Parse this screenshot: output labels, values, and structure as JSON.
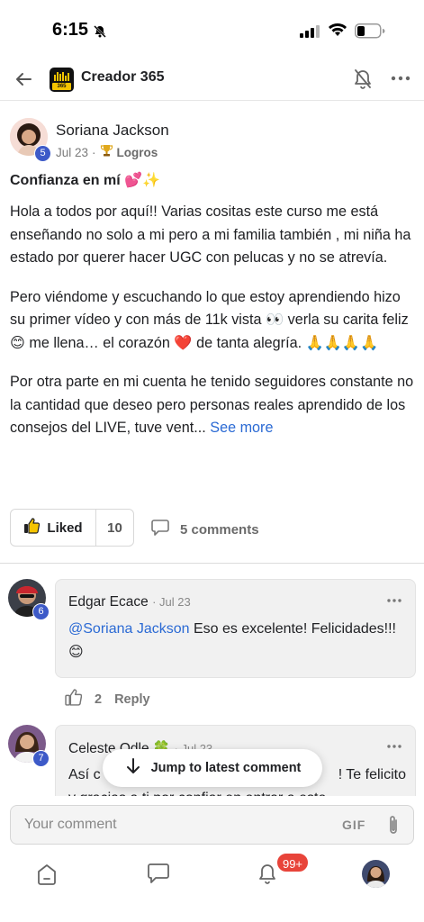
{
  "status_bar": {
    "time": "6:15"
  },
  "header": {
    "community_name": "Creador 365",
    "logo_text": "365"
  },
  "post": {
    "author": "Soriana Jackson",
    "author_level": "5",
    "date": "Jul 23",
    "separator": "·",
    "category": "Logros",
    "title": "Confianza en mí 💕✨",
    "paragraphs": [
      "Hola a todos por aquí!! Varias cositas este curso me está enseñando no solo a mi pero a mi familia también , mi niña ha estado por querer hacer UGC con pelucas y no se atrevía.",
      "Pero viéndome y escuchando lo que estoy aprendiendo hizo su primer vídeo y con más de 11k vista 👀 verla su carita feliz 😊 me llena… el corazón ❤️ de tanta alegría. 🙏🙏🙏🙏",
      "Por otra parte en mi cuenta he tenido seguidores constante no la cantidad que deseo pero personas reales aprendido de los consejos del LIVE, tuve vent..."
    ],
    "see_more": "See more",
    "liked_label": "Liked",
    "like_count": "10",
    "comments_label": "5 comments"
  },
  "comments": [
    {
      "author": "Edgar Ecace",
      "date": "· Jul 23",
      "level": "6",
      "mention": "@Soriana Jackson",
      "text": " Eso es excelente! Felicidades!!! 😊",
      "like_count": "2",
      "reply_label": "Reply"
    },
    {
      "author": "Celeste Odle 🍀",
      "date": "· Jul 23",
      "level": "7",
      "text_start": "Así c",
      "text_end": "! Te felicito",
      "text_line2": "y gracias a ti por confiar en entrar a este"
    }
  ],
  "jump_toast": "Jump to latest comment",
  "composer": {
    "placeholder": "Your comment",
    "gif_label": "GIF"
  },
  "tab_bar": {
    "notifications_badge": "99+"
  },
  "colors": {
    "link": "#2b6ad4",
    "level_badge": "#3d5ac8",
    "notification_badge": "#e8443a"
  }
}
